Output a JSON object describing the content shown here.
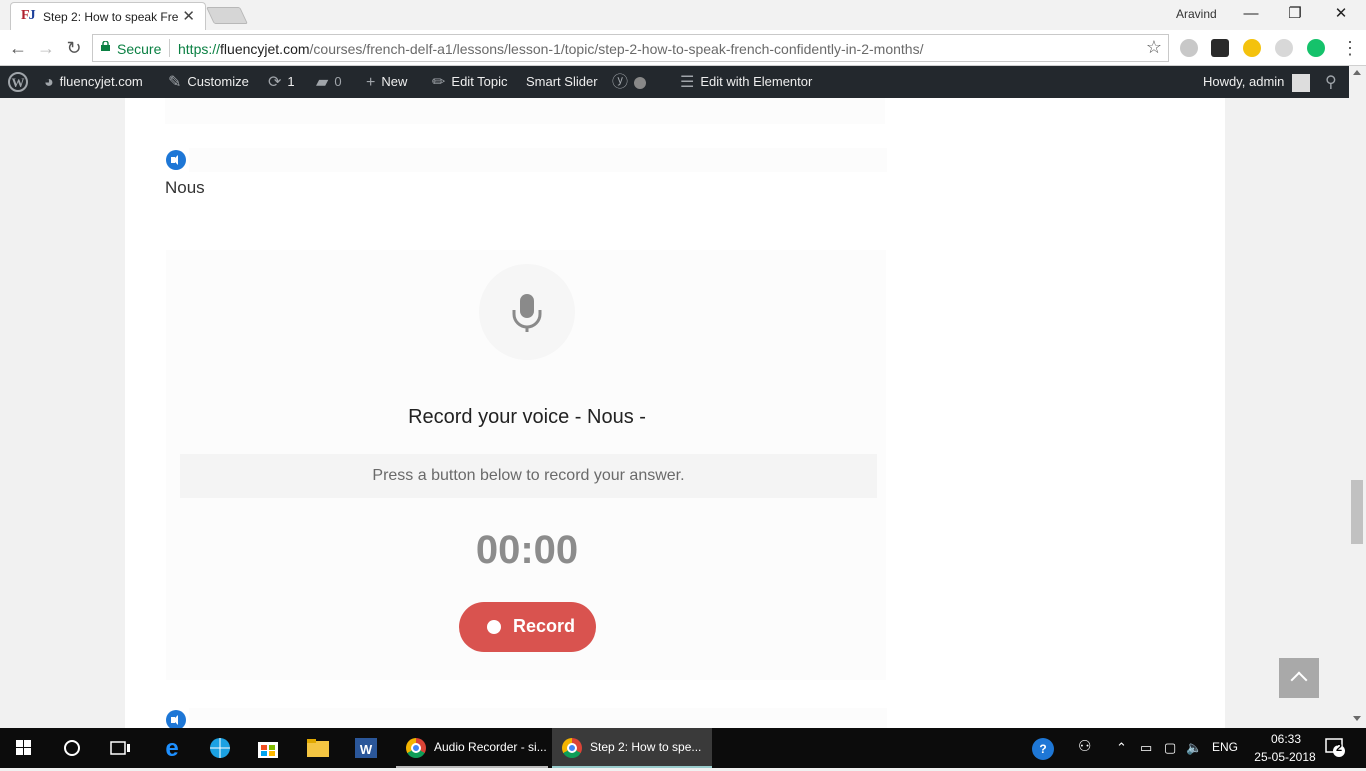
{
  "browser": {
    "tab_title": "Step 2: How to speak Fre",
    "favicon_text": "FJ",
    "user_name": "Aravind",
    "secure_label": "Secure",
    "url_scheme": "https://",
    "url_host": "fluencyjet.com",
    "url_path": "/courses/french-delf-a1/lessons/lesson-1/topic/step-2-how-to-speak-french-confidently-in-2-months/"
  },
  "adminbar": {
    "site": "fluencyjet.com",
    "customize": "Customize",
    "updates_count": "1",
    "comments_count": "0",
    "new": "New",
    "edit_topic": "Edit Topic",
    "smart_slider": "Smart Slider",
    "elementor": "Edit with Elementor",
    "howdy": "Howdy, admin"
  },
  "content": {
    "word": "Nous",
    "record_title": "Record your voice - Nous -",
    "prompt": "Press a button below to record your answer.",
    "timer": "00:00",
    "record_button": "Record"
  },
  "taskbar": {
    "app1": "Audio Recorder - si...",
    "app2": "Step 2: How to spe...",
    "language": "ENG",
    "time": "06:33",
    "date": "25-05-2018",
    "notifications": "2"
  },
  "colors": {
    "record_button": "#d9534f",
    "admin_bar": "#23282d",
    "speaker_icon": "#1e77d6",
    "secure_green": "#0b8043"
  }
}
